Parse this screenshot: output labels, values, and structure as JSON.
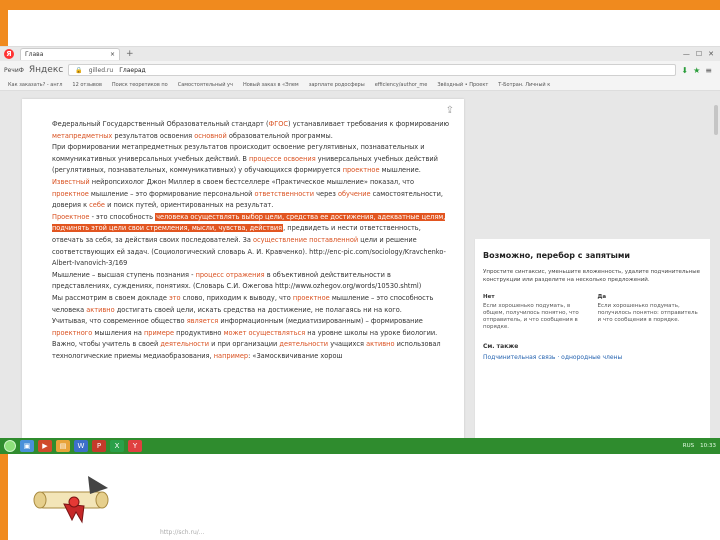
{
  "browser": {
    "tab_title": "Глава",
    "nav": {
      "yandex_label": "Яндекс",
      "back_label": "РечиФ",
      "url": "gilled.ru",
      "page_title": "Глаерад"
    },
    "bookmarks": [
      "Как заказать? - англ",
      "12 отзывов",
      "Поиск теоретиков по",
      "Самостоятельный уч",
      "Новый заказ в «Элем",
      "зарплате родосферы",
      "efficiency/author_me",
      "Звёздный • Проект",
      "Т-Ботран. Личный к"
    ]
  },
  "document": {
    "paragraphs": [
      [
        {
          "t": "Федеральный Государственный Образовательный стандарт ("
        },
        {
          "t": "ФГОС",
          "c": "red"
        },
        {
          "t": ") устанавливает требования к формированию "
        },
        {
          "t": "метапредметных",
          "c": "red"
        },
        {
          "t": " результатов освоения "
        },
        {
          "t": "основной",
          "c": "red"
        },
        {
          "t": " образовательной программы."
        }
      ],
      [
        {
          "t": "При формировании метапредметных результатов происходит освоение регулятивных, познавательных и коммуникативных универсальных учебных действий. В "
        },
        {
          "t": "процессе освоения",
          "c": "red"
        },
        {
          "t": " универсальных учебных действий (регулятивных, познавательных, коммуникативных) у обучающихся  формируется "
        },
        {
          "t": "проектное",
          "c": "red"
        },
        {
          "t": " мышление."
        }
      ],
      [
        {
          "t": "Известный",
          "c": "red"
        },
        {
          "t": " нейропсихолог Джон Миллер в своем бестселлере «Практическое мышление» показал, что "
        },
        {
          "t": "проектное",
          "c": "red"
        },
        {
          "t": " мышление – это формирование персональной "
        },
        {
          "t": "ответственности",
          "c": "red"
        },
        {
          "t": " через "
        },
        {
          "t": "обучение",
          "c": "red"
        },
        {
          "t": " самостоятельности, доверия к "
        },
        {
          "t": "себе",
          "c": "red"
        },
        {
          "t": " и поиск путей, ориентированных на результат."
        }
      ],
      [
        {
          "t": "Проектное",
          "c": "red"
        },
        {
          "t": " - это способность "
        },
        {
          "t": "человека осуществлять выбор цели, средства ее достижения, адекватные целям, подчинять этой цели свои стремления, мысли, чувства, действия",
          "c": "hl"
        },
        {
          "t": ", предвидеть и нести ответственность, отвечать за себя, за действия своих последователей. За "
        },
        {
          "t": "осуществление поставленной",
          "c": "red"
        },
        {
          "t": " цели и решение соответствующих ей задач. (Социологический словарь А. И. Кравченко). http://enc-pic.com/sociology/Kravchenko-Albert-Ivanovich-3/169"
        }
      ],
      [
        {
          "t": "Мышление – высшая ступень познания - "
        },
        {
          "t": "процесс отражения",
          "c": "red"
        },
        {
          "t": " в объективной действительности в представлениях, суждениях, понятиях. (Словарь С.И. Ожегова http://www.ozhegov.org/words/10530.shtml)"
        }
      ],
      [
        {
          "t": "Мы рассмотрим в своем докладе "
        },
        {
          "t": "это",
          "c": "red"
        },
        {
          "t": " слово, приходим к выводу, что "
        },
        {
          "t": "проектное",
          "c": "red"
        },
        {
          "t": " мышление – это способность человека "
        },
        {
          "t": "активно",
          "c": "red"
        },
        {
          "t": " достигать своей цели, искать средства на достижение, не полагаясь ни на кого."
        }
      ],
      [
        {
          "t": "Учитывая, что современное общество "
        },
        {
          "t": "является",
          "c": "red"
        },
        {
          "t": " информационным (медиатизированным) – формирование "
        },
        {
          "t": "проектного",
          "c": "red"
        },
        {
          "t": " мышления на "
        },
        {
          "t": "примере",
          "c": "red"
        },
        {
          "t": " продуктивно "
        },
        {
          "t": "может осуществляться",
          "c": "red"
        },
        {
          "t": " на уровне школы на уроке биологии. Важно, чтобы учитель в своей "
        },
        {
          "t": "деятельности",
          "c": "red"
        },
        {
          "t": " и при организации "
        },
        {
          "t": "деятельности",
          "c": "red"
        },
        {
          "t": " учащихся "
        },
        {
          "t": "активно",
          "c": "red"
        },
        {
          "t": " использовал технологические приемы медиаобразования, "
        },
        {
          "t": "например",
          "c": "red"
        },
        {
          "t": ": «Замосквичивание хорош"
        }
      ]
    ]
  },
  "sidepanel": {
    "title": "Возможно, перебор с запятыми",
    "description": "Упростите синтаксис, уменьшите вложенность, удалите подчинительные конструкции или разделите на несколько предложений.",
    "col_no": {
      "head": "Нет",
      "body": "Если хорошенько подумать, в общем, получилось понятно, что отправитель, и что сообщения в порядке."
    },
    "col_yes": {
      "head": "Да",
      "body": "Если хорошенько подумать, получилось понятно: отправитель и что сообщения в порядке."
    },
    "see_also": "См. также",
    "link": "Подчинительная связь · однородные члены"
  },
  "taskbar": {
    "lang": "RUS",
    "time": "10:33"
  },
  "footer": "http://sch.ru/..."
}
